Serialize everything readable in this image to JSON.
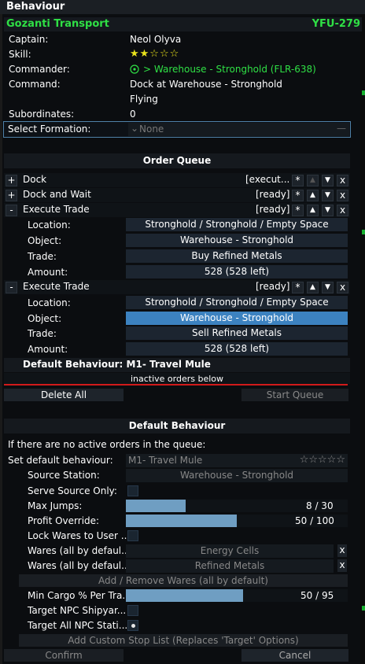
{
  "window": {
    "title": "Behaviour"
  },
  "ship": {
    "name": "Gozanti Transport",
    "code": "YFU-279"
  },
  "info": {
    "captain_label": "Captain:",
    "captain": "Neol Olyva",
    "skill_label": "Skill:",
    "skill_stars": "★★☆☆☆",
    "commander_label": "Commander:",
    "commander": "> Warehouse - Stronghold (FLR-638)",
    "command_label": "Command:",
    "command": "Dock at Warehouse - Stronghold",
    "status": "Flying",
    "subordinates_label": "Subordinates:",
    "subordinates": "0"
  },
  "formation": {
    "label": "Select Formation:",
    "value": "None",
    "chevron": "⌄",
    "dash": "—"
  },
  "order_queue": {
    "title": "Order Queue",
    "orders": [
      {
        "toggle": "+",
        "name": "Dock",
        "status": "[execut..."
      },
      {
        "toggle": "+",
        "name": "Dock and Wait",
        "status": "[ready]"
      },
      {
        "toggle": "-",
        "name": "Execute Trade",
        "status": "[ready]"
      },
      {
        "toggle": "-",
        "name": "Execute Trade",
        "status": "[ready]"
      }
    ],
    "trade1": {
      "location_label": "Location:",
      "location": "Stronghold / Stronghold / Empty Space",
      "object_label": "Object:",
      "object": "Warehouse - Stronghold",
      "trade_label": "Trade:",
      "trade": "Buy Refined Metals",
      "amount_label": "Amount:",
      "amount": "528 (528 left)"
    },
    "trade2": {
      "location_label": "Location:",
      "location": "Stronghold / Stronghold / Empty Space",
      "object_label": "Object:",
      "object": "Warehouse - Stronghold",
      "trade_label": "Trade:",
      "trade": "Sell Refined Metals",
      "amount_label": "Amount:",
      "amount": "528 (528 left)"
    },
    "default_behaviour_row": "Default Behaviour: M1- Travel Mule",
    "inactive_note": "inactive orders below",
    "delete_all": "Delete All",
    "start_queue": "Start Queue",
    "btn_star": "*",
    "btn_up": "▲",
    "btn_down": "▼",
    "btn_x": "x"
  },
  "default_behaviour": {
    "title": "Default Behaviour",
    "intro": "If there are no active orders in the queue:",
    "set_label": "Set default behaviour:",
    "set_value": "M1- Travel Mule",
    "set_stars": "☆☆☆☆☆",
    "source_station_label": "Source Station:",
    "source_station": "Warehouse - Stronghold",
    "serve_source_label": "Serve Source Only:",
    "max_jumps_label": "Max Jumps:",
    "max_jumps": "8 / 30",
    "max_jumps_fraction": 0.27,
    "profit_label": "Profit Override:",
    "profit": "50 / 100",
    "profit_fraction": 0.5,
    "lock_wares_label": "Lock Wares to User ...",
    "wares1_label": "Wares (all by defaul...",
    "wares1": "Energy Cells",
    "wares2_label": "Wares (all by defaul...",
    "wares2": "Refined Metals",
    "add_remove": "Add / Remove Wares (all by default)",
    "min_cargo_label": "Min Cargo % Per Tra...",
    "min_cargo": "50 / 95",
    "min_cargo_fraction": 0.53,
    "target_shipyard_label": "Target NPC Shipyar...",
    "target_all_label": "Target All NPC Stati...",
    "custom_stop": "Add Custom Stop List (Replaces 'Target' Options)",
    "confirm": "Confirm",
    "cancel": "Cancel"
  },
  "colors": {
    "accent_green": "#2fe045",
    "selected_blue": "#3c82c0",
    "bar_blue": "#6f9ec2",
    "divider_red": "#d11a1a",
    "stars_yellow": "#e8e21c"
  }
}
